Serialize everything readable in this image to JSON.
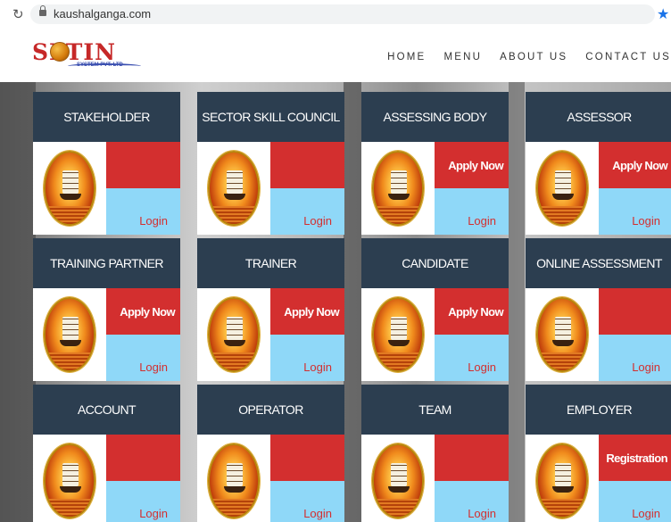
{
  "browser": {
    "url": "kaushalganga.com"
  },
  "site": {
    "logo_text": "SFTIN",
    "logo_sub": "SYSTEM PVT. LTD",
    "nav": [
      "HOME",
      "MENU",
      "ABOUT US",
      "CONTACT US"
    ]
  },
  "cards": [
    {
      "title": "STAKEHOLDER",
      "action": "",
      "login": "Login"
    },
    {
      "title": "SECTOR SKILL COUNCIL",
      "action": "",
      "login": "Login"
    },
    {
      "title": "ASSESSING BODY",
      "action": "Apply Now",
      "login": "Login"
    },
    {
      "title": "ASSESSOR",
      "action": "Apply Now",
      "login": "Login"
    },
    {
      "title": "TRAINING PARTNER",
      "action": "Apply Now",
      "login": "Login"
    },
    {
      "title": "TRAINER",
      "action": "Apply Now",
      "login": "Login"
    },
    {
      "title": "CANDIDATE",
      "action": "Apply Now",
      "login": "Login"
    },
    {
      "title": "ONLINE ASSESSMENT",
      "action": "",
      "login": "Login"
    },
    {
      "title": "ACCOUNT",
      "action": "",
      "login": "Login"
    },
    {
      "title": "OPERATOR",
      "action": "",
      "login": "Login"
    },
    {
      "title": "TEAM",
      "action": "",
      "login": "Login"
    },
    {
      "title": "EMPLOYER",
      "action": "Registration",
      "login": "Login"
    }
  ]
}
